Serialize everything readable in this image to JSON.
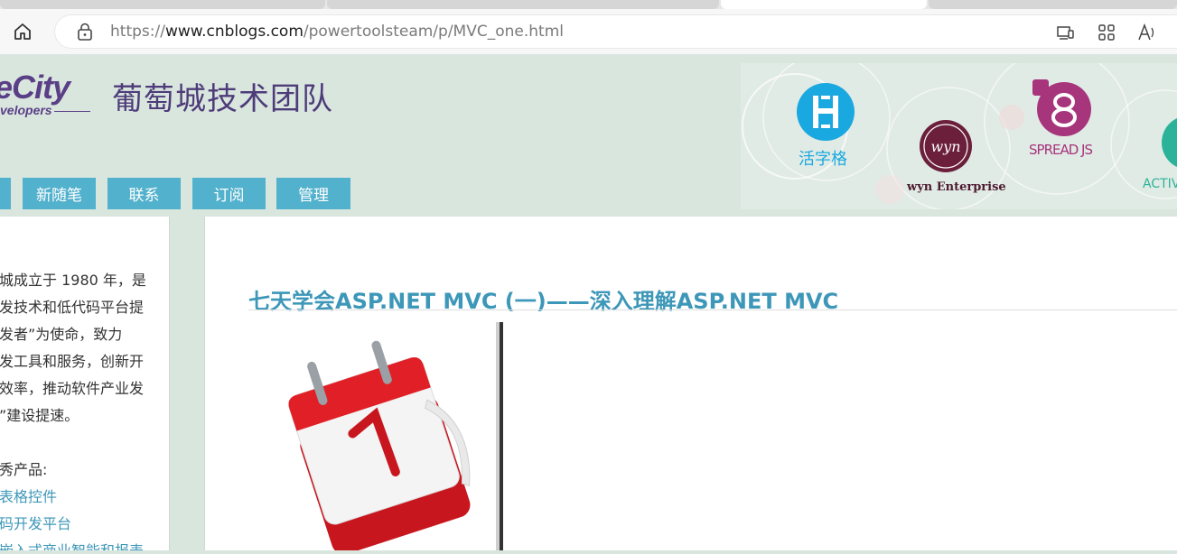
{
  "browser": {
    "url_prefix": "https://",
    "url_host": "www.cnblogs.com",
    "url_path": "/powertoolsteam/p/MVC_one.html",
    "icons": [
      "home-icon",
      "lock-icon",
      "device-icon",
      "apps-icon",
      "read-aloud-icon"
    ]
  },
  "header": {
    "logo_text": "eCity",
    "logo_subtext": "velopers",
    "site_title": "葡萄城技术团队",
    "banner_products": [
      "活字格",
      "wyn Enterprise",
      "SPREAD JS",
      "ACTIV"
    ]
  },
  "nav": {
    "items": [
      "新随笔",
      "联系",
      "订阅",
      "管理"
    ]
  },
  "sidebar": {
    "lines": [
      "城成立于 1980 年，是",
      "发技术和低代码平台提",
      "发者”为使命，致力",
      "发工具和服务，创新开",
      "效率，推动软件产业发",
      "”建设提速。"
    ],
    "products_heading": "秀产品:",
    "links": [
      "表格控件",
      "码开发平台",
      "嵌入式商业智能和报表"
    ]
  },
  "post": {
    "title": "七天学会ASP.NET MVC (一)——深入理解ASP.NET MVC",
    "image_icon": "calendar-icon",
    "image_number": "1"
  },
  "colors": {
    "accent": "#52b1cc",
    "title_blue": "#3d97b8",
    "brand_purple": "#5a3f87",
    "page_bg": "#d9e6de"
  }
}
